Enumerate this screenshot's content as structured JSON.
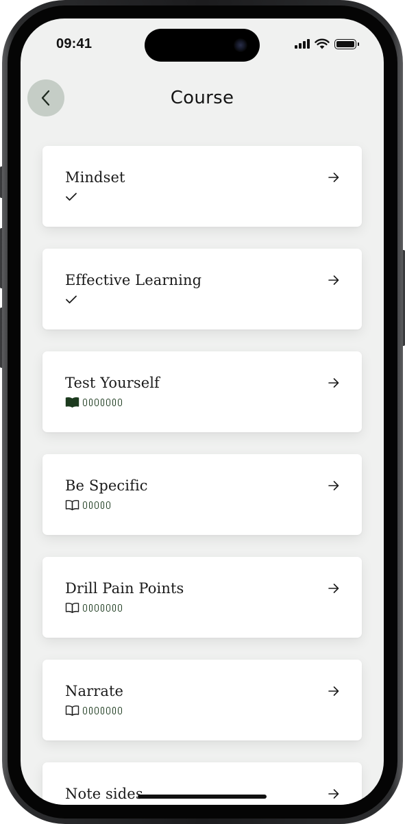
{
  "status_bar": {
    "time": "09:41"
  },
  "header": {
    "title": "Course"
  },
  "courses": [
    {
      "title": "Mindset",
      "status": "completed"
    },
    {
      "title": "Effective Learning",
      "status": "completed"
    },
    {
      "title": "Test Yourself",
      "status": "in-progress",
      "icon": "book-filled-icon",
      "lessons": 7
    },
    {
      "title": "Be Specific",
      "status": "not-started",
      "icon": "book-outline-icon",
      "lessons": 5
    },
    {
      "title": "Drill Pain Points",
      "status": "not-started",
      "icon": "book-outline-icon",
      "lessons": 7
    },
    {
      "title": "Narrate",
      "status": "not-started",
      "icon": "book-outline-icon",
      "lessons": 7
    },
    {
      "title": "Note sides",
      "status": "not-started"
    }
  ],
  "colors": {
    "accent": "#1c3a1e",
    "back_button_bg": "#c5cdc6",
    "screen_bg": "#f0f1f0"
  }
}
